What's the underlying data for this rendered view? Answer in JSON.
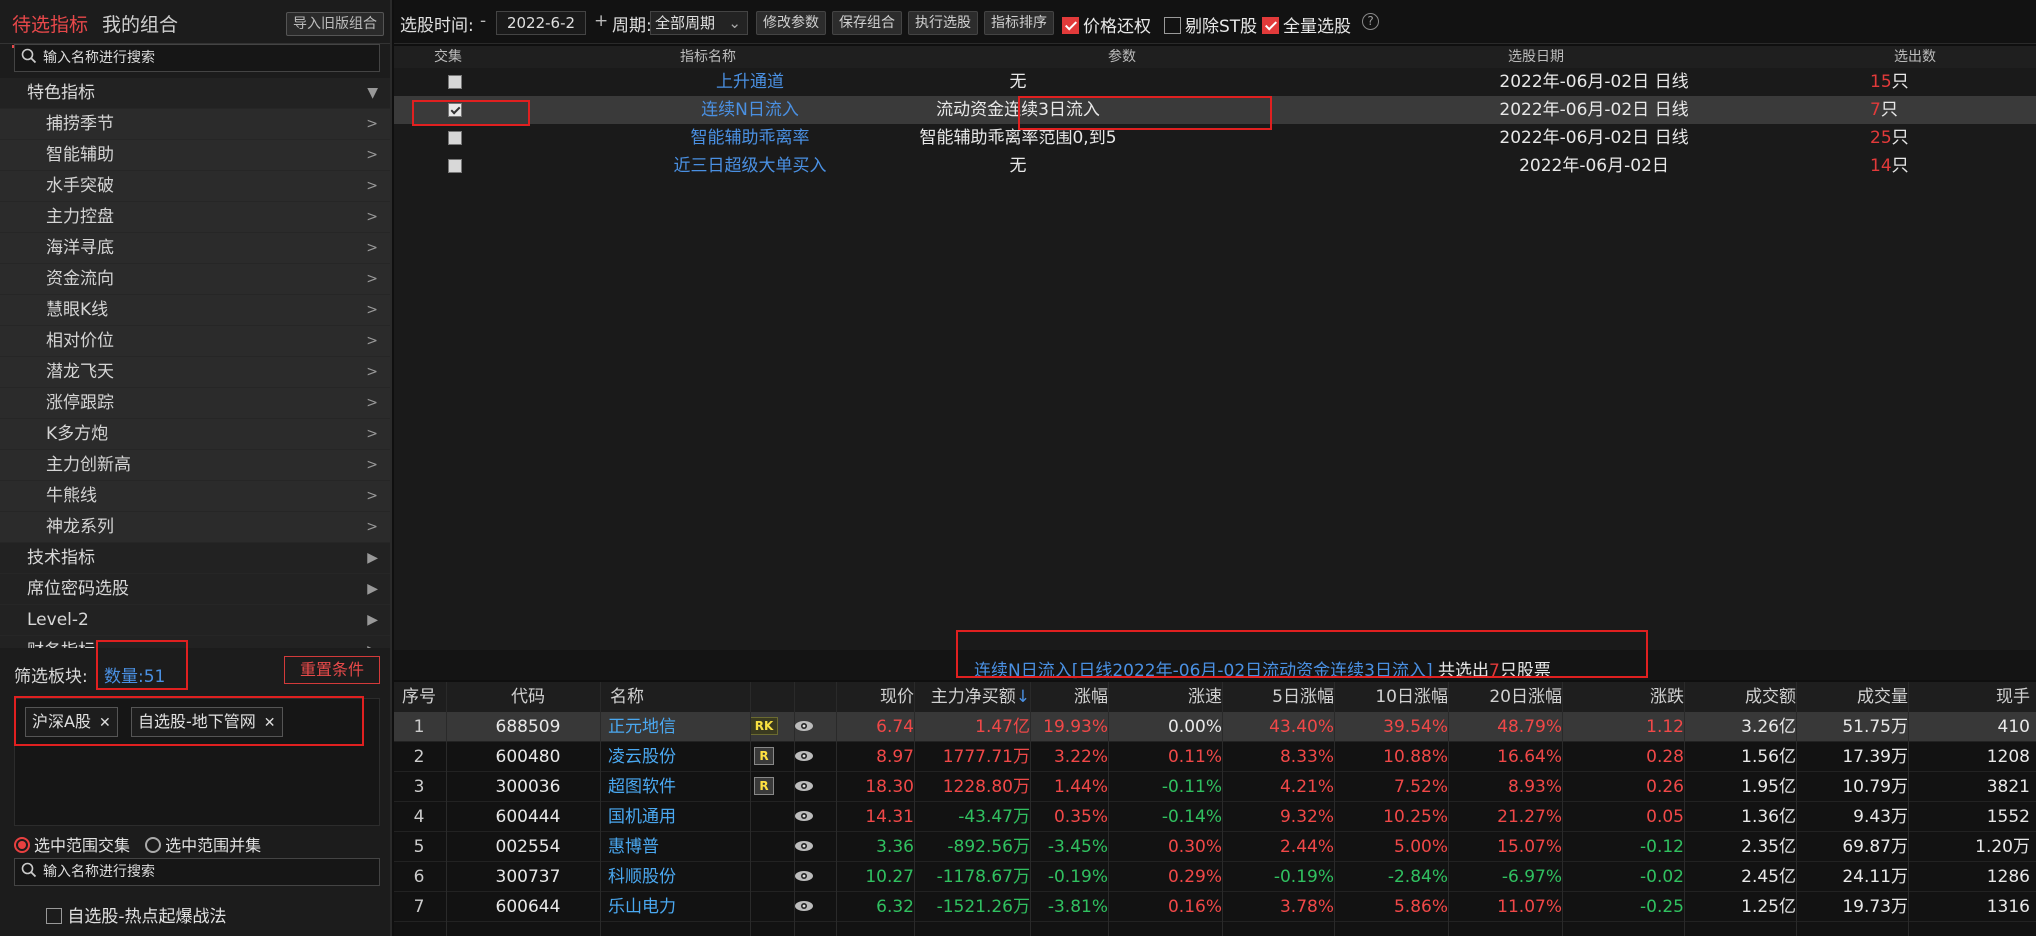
{
  "sidebar": {
    "tabs": [
      "待选指标",
      "我的组合"
    ],
    "import_btn": "导入旧版组合",
    "search_placeholder": "输入名称进行搜索",
    "menu": [
      {
        "label": "特色指标",
        "level": 1,
        "arrow": "▼"
      },
      {
        "label": "捕捞季节",
        "level": 2,
        "arrow": ">"
      },
      {
        "label": "智能辅助",
        "level": 2,
        "arrow": ">"
      },
      {
        "label": "水手突破",
        "level": 2,
        "arrow": ">"
      },
      {
        "label": "主力控盘",
        "level": 2,
        "arrow": ">"
      },
      {
        "label": "海洋寻底",
        "level": 2,
        "arrow": ">"
      },
      {
        "label": "资金流向",
        "level": 2,
        "arrow": ">"
      },
      {
        "label": "慧眼K线",
        "level": 2,
        "arrow": ">"
      },
      {
        "label": "相对价位",
        "level": 2,
        "arrow": ">"
      },
      {
        "label": "潜龙飞天",
        "level": 2,
        "arrow": ">"
      },
      {
        "label": "涨停跟踪",
        "level": 2,
        "arrow": ">"
      },
      {
        "label": "K多方炮",
        "level": 2,
        "arrow": ">"
      },
      {
        "label": "主力创新高",
        "level": 2,
        "arrow": ">"
      },
      {
        "label": "牛熊线",
        "level": 2,
        "arrow": ">"
      },
      {
        "label": "神龙系列",
        "level": 2,
        "arrow": ">"
      },
      {
        "label": "技术指标",
        "level": 1,
        "arrow": "▶"
      },
      {
        "label": "席位密码选股",
        "level": 1,
        "arrow": "▶"
      },
      {
        "label": "Level-2",
        "level": 1,
        "arrow": "▶"
      },
      {
        "label": "财务指标",
        "level": 1,
        "arrow": "▶"
      }
    ],
    "filter_label": "筛选板块:",
    "filter_count": "数量:51",
    "reset_btn": "重置条件",
    "chips": [
      "沪深A股",
      "自选股-地下管网"
    ],
    "radio_and": "选中范围交集",
    "radio_or": "选中范围并集",
    "search2_placeholder": "输入名称进行搜索",
    "list_item": "自选股-热点起爆战法"
  },
  "toolbar": {
    "date_label": "选股时间:",
    "minus": "-",
    "date": "2022-6-2",
    "plus": "+",
    "period_label": "周期:",
    "period": "全部周期",
    "btn_modify": "修改参数",
    "btn_save": "保存组合",
    "btn_exec": "执行选股",
    "btn_sort": "指标排序",
    "cb_price": "价格还权",
    "cb_st": "剔除ST股",
    "cb_all": "全量选股",
    "help": "?"
  },
  "indicator_table": {
    "headers": [
      "交集",
      "指标名称",
      "参数",
      "选股日期",
      "选出数"
    ],
    "rows": [
      {
        "checked": false,
        "name": "上升通道",
        "param": "无",
        "date": "2022年-06月-02日 日线",
        "count": "15",
        "unit": "只"
      },
      {
        "checked": true,
        "name": "连续N日流入",
        "param": "流动资金连续3日流入",
        "date": "2022年-06月-02日 日线",
        "count": "7",
        "unit": "只"
      },
      {
        "checked": false,
        "name": "智能辅助乖离率",
        "param": "智能辅助乖离率范围0,到5",
        "date": "2022年-06月-02日 日线",
        "count": "25",
        "unit": "只"
      },
      {
        "checked": false,
        "name": "近三日超级大单买入",
        "param": "无",
        "date": "2022年-06月-02日",
        "count": "14",
        "unit": "只"
      }
    ]
  },
  "result_bar": {
    "blue": "连续N日流入[日线2022年-06月-02日流动资金连续3日流入]",
    "mid": " 共选出",
    "count": "7",
    "tail": "只股票"
  },
  "stock_table": {
    "headers": [
      "序号",
      "代码",
      "名称",
      "现价",
      "主力净买额",
      "涨幅",
      "涨速",
      "5日涨幅",
      "10日涨幅",
      "20日涨幅",
      "涨跌",
      "成交额",
      "成交量",
      "现手"
    ],
    "sort_arrow": "↓",
    "rows": [
      {
        "idx": "1",
        "code": "688509",
        "name": "正元地信",
        "tag": "RK",
        "price": "6.74",
        "net": "1.47亿",
        "chg": "19.93%",
        "speed": "0.00%",
        "d5": "43.40%",
        "d10": "39.54%",
        "d20": "48.79%",
        "diff": "1.12",
        "amt": "3.26亿",
        "vol": "51.75万",
        "hand": "410",
        "c": [
          "up",
          "up",
          "up",
          "wt",
          "up",
          "up",
          "up",
          "up"
        ]
      },
      {
        "idx": "2",
        "code": "600480",
        "name": "凌云股份",
        "tag": "R",
        "price": "8.97",
        "net": "1777.71万",
        "chg": "3.22%",
        "speed": "0.11%",
        "d5": "8.33%",
        "d10": "10.88%",
        "d20": "16.64%",
        "diff": "0.28",
        "amt": "1.56亿",
        "vol": "17.39万",
        "hand": "1208",
        "c": [
          "up",
          "up",
          "up",
          "up",
          "up",
          "up",
          "up",
          "up"
        ]
      },
      {
        "idx": "3",
        "code": "300036",
        "name": "超图软件",
        "tag": "R",
        "price": "18.30",
        "net": "1228.80万",
        "chg": "1.44%",
        "speed": "-0.11%",
        "d5": "4.21%",
        "d10": "7.52%",
        "d20": "8.93%",
        "diff": "0.26",
        "amt": "1.95亿",
        "vol": "10.79万",
        "hand": "3821",
        "c": [
          "up",
          "up",
          "up",
          "dn",
          "up",
          "up",
          "up",
          "up"
        ]
      },
      {
        "idx": "4",
        "code": "600444",
        "name": "国机通用",
        "tag": "",
        "price": "14.31",
        "net": "-43.47万",
        "chg": "0.35%",
        "speed": "-0.14%",
        "d5": "9.32%",
        "d10": "10.25%",
        "d20": "21.27%",
        "diff": "0.05",
        "amt": "1.36亿",
        "vol": "9.43万",
        "hand": "1552",
        "c": [
          "up",
          "dn",
          "up",
          "dn",
          "up",
          "up",
          "up",
          "up"
        ]
      },
      {
        "idx": "5",
        "code": "002554",
        "name": "惠博普",
        "tag": "",
        "price": "3.36",
        "net": "-892.56万",
        "chg": "-3.45%",
        "speed": "0.30%",
        "d5": "2.44%",
        "d10": "5.00%",
        "d20": "15.07%",
        "diff": "-0.12",
        "amt": "2.35亿",
        "vol": "69.87万",
        "hand": "1.20万",
        "c": [
          "dn",
          "dn",
          "dn",
          "up",
          "up",
          "up",
          "up",
          "dn"
        ]
      },
      {
        "idx": "6",
        "code": "300737",
        "name": "科顺股份",
        "tag": "",
        "price": "10.27",
        "net": "-1178.67万",
        "chg": "-0.19%",
        "speed": "0.29%",
        "d5": "-0.19%",
        "d10": "-2.84%",
        "d20": "-6.97%",
        "diff": "-0.02",
        "amt": "2.45亿",
        "vol": "24.11万",
        "hand": "1286",
        "c": [
          "dn",
          "dn",
          "dn",
          "up",
          "dn",
          "dn",
          "dn",
          "dn"
        ]
      },
      {
        "idx": "7",
        "code": "600644",
        "name": "乐山电力",
        "tag": "",
        "price": "6.32",
        "net": "-1521.26万",
        "chg": "-3.81%",
        "speed": "0.16%",
        "d5": "3.78%",
        "d10": "5.86%",
        "d20": "11.07%",
        "diff": "-0.25",
        "amt": "1.25亿",
        "vol": "19.73万",
        "hand": "1316",
        "c": [
          "dn",
          "dn",
          "dn",
          "up",
          "up",
          "up",
          "up",
          "dn"
        ]
      }
    ]
  },
  "colors": {
    "accent_red": "#e23a3a",
    "link_blue": "#4a90e2",
    "up": "#f04848",
    "down": "#30c060"
  }
}
